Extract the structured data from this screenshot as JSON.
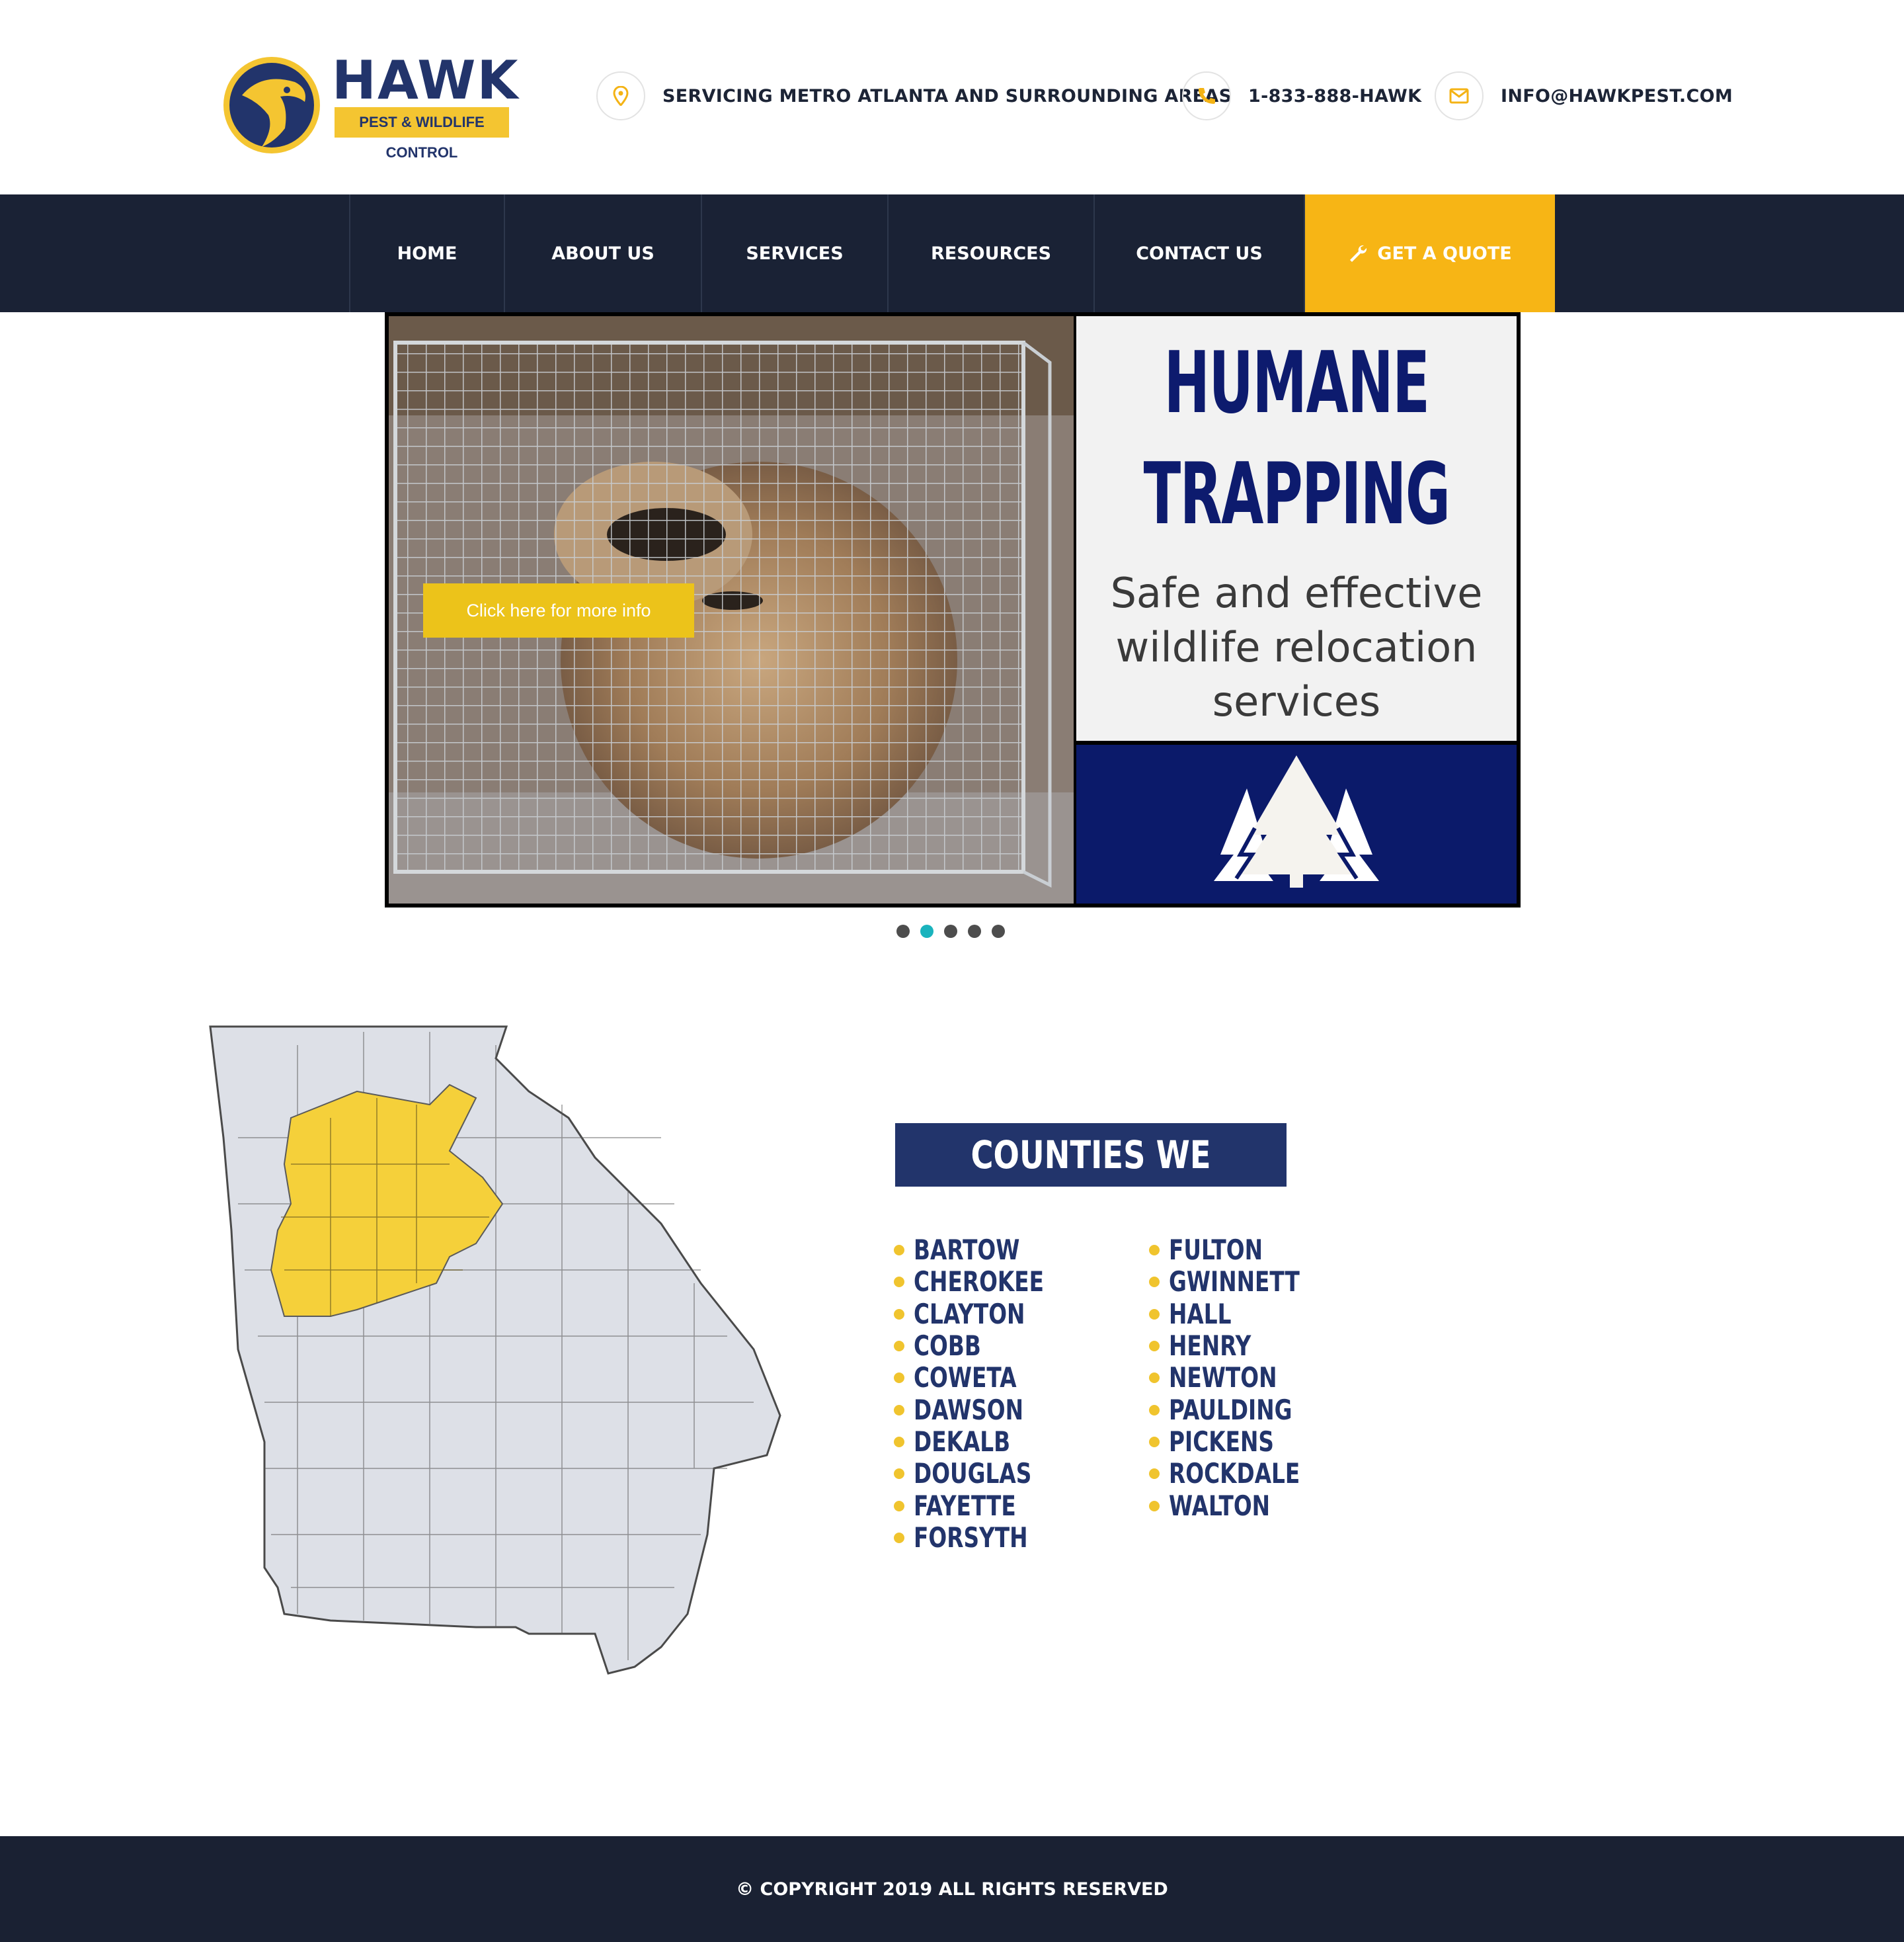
{
  "brand": {
    "name": "HAWK",
    "tagline": "PEST & WILDLIFE CONTROL",
    "colors": {
      "navy": "#22346b",
      "gold": "#f4c531",
      "nav_bg": "#1a2235",
      "quote_bg": "#f7b515"
    }
  },
  "header": {
    "location": {
      "icon": "map-pin-icon",
      "text": "SERVICING METRO ATLANTA AND SURROUNDING AREAS"
    },
    "phone": {
      "icon": "phone-icon",
      "text": "1-833-888-HAWK"
    },
    "email": {
      "icon": "envelope-icon",
      "text": "INFO@HAWKPEST.COM"
    }
  },
  "nav": {
    "items": [
      {
        "label": "HOME"
      },
      {
        "label": "ABOUT US"
      },
      {
        "label": "SERVICES"
      },
      {
        "label": "RESOURCES"
      },
      {
        "label": "CONTACT US"
      }
    ],
    "quote": {
      "label": "GET A QUOTE",
      "icon": "wrench-icon"
    }
  },
  "slider": {
    "cta": "Click here for more info",
    "headline_1": "HUMANE",
    "headline_2": "TRAPPING",
    "subtitle": "Safe and effective wildlife relocation services",
    "badge_icon": "pine-trees-icon",
    "slide_count": 5,
    "active_slide": 2
  },
  "counties": {
    "title": "COUNTIES WE SERVE",
    "left": [
      "BARTOW",
      "CHEROKEE",
      "CLAYTON",
      "COBB",
      "COWETA",
      "DAWSON",
      "DEKALB",
      "DOUGLAS",
      "FAYETTE",
      "FORSYTH"
    ],
    "right": [
      "FULTON",
      "GWINNETT",
      "HALL",
      "HENRY",
      "NEWTON",
      "PAULDING",
      "PICKENS",
      "ROCKDALE",
      "WALTON"
    ]
  },
  "footer": {
    "copyright": "© COPYRIGHT 2019 ALL RIGHTS RESERVED"
  }
}
